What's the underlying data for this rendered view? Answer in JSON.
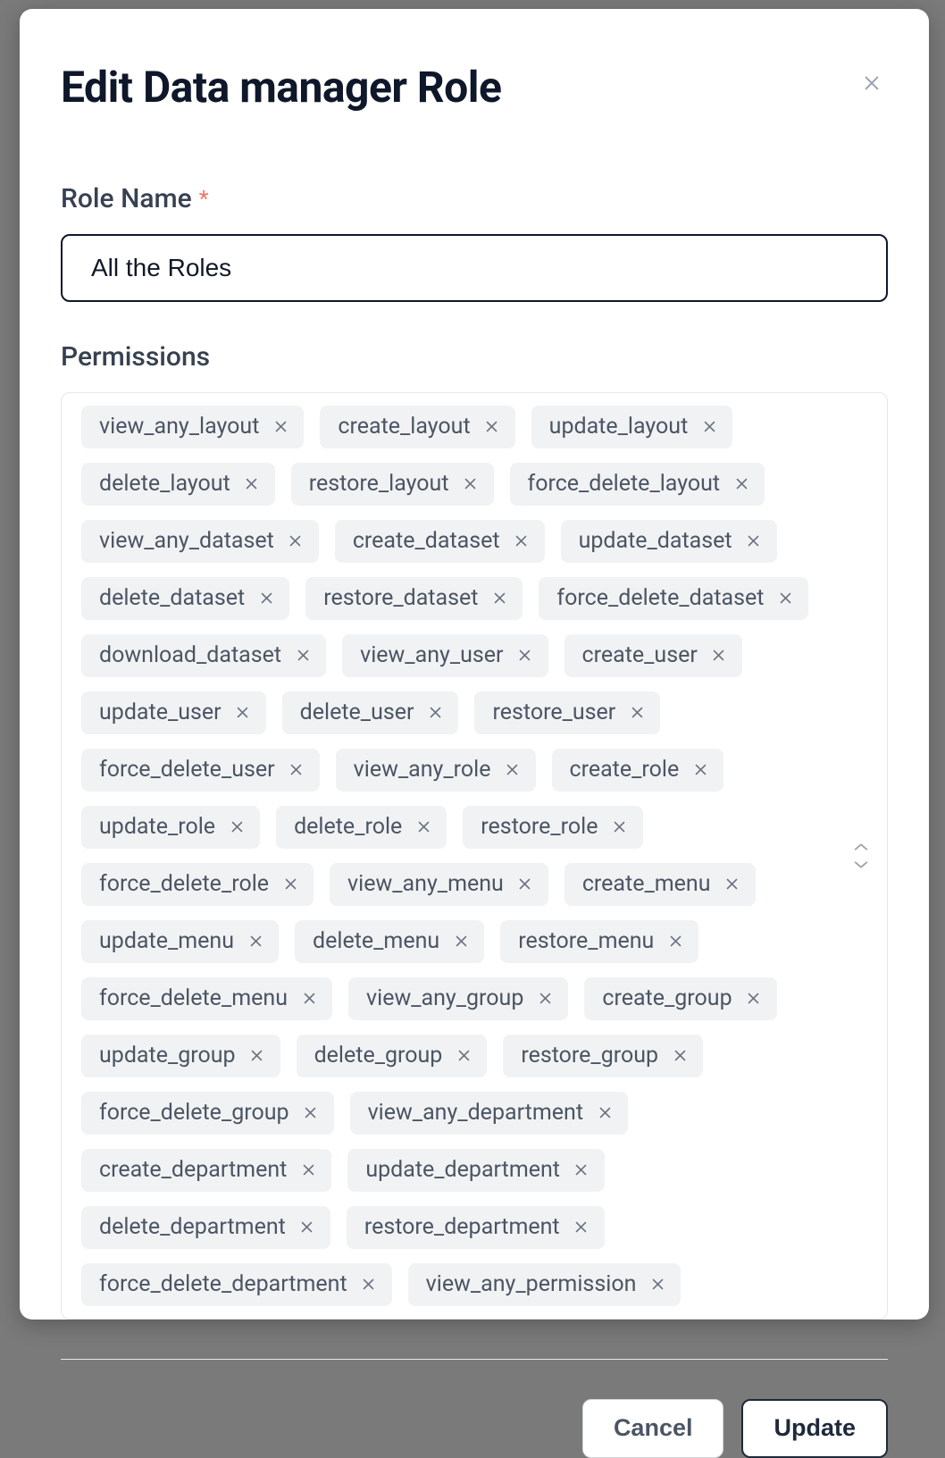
{
  "modal": {
    "title": "Edit Data manager Role"
  },
  "roleName": {
    "label": "Role Name",
    "required_marker": "*",
    "value": "All the Roles"
  },
  "permissions": {
    "label": "Permissions",
    "items": [
      "view_any_layout",
      "create_layout",
      "update_layout",
      "delete_layout",
      "restore_layout",
      "force_delete_layout",
      "view_any_dataset",
      "create_dataset",
      "update_dataset",
      "delete_dataset",
      "restore_dataset",
      "force_delete_dataset",
      "download_dataset",
      "view_any_user",
      "create_user",
      "update_user",
      "delete_user",
      "restore_user",
      "force_delete_user",
      "view_any_role",
      "create_role",
      "update_role",
      "delete_role",
      "restore_role",
      "force_delete_role",
      "view_any_menu",
      "create_menu",
      "update_menu",
      "delete_menu",
      "restore_menu",
      "force_delete_menu",
      "view_any_group",
      "create_group",
      "update_group",
      "delete_group",
      "restore_group",
      "force_delete_group",
      "view_any_department",
      "create_department",
      "update_department",
      "delete_department",
      "restore_department",
      "force_delete_department",
      "view_any_permission"
    ]
  },
  "footer": {
    "cancel": "Cancel",
    "submit": "Update"
  }
}
